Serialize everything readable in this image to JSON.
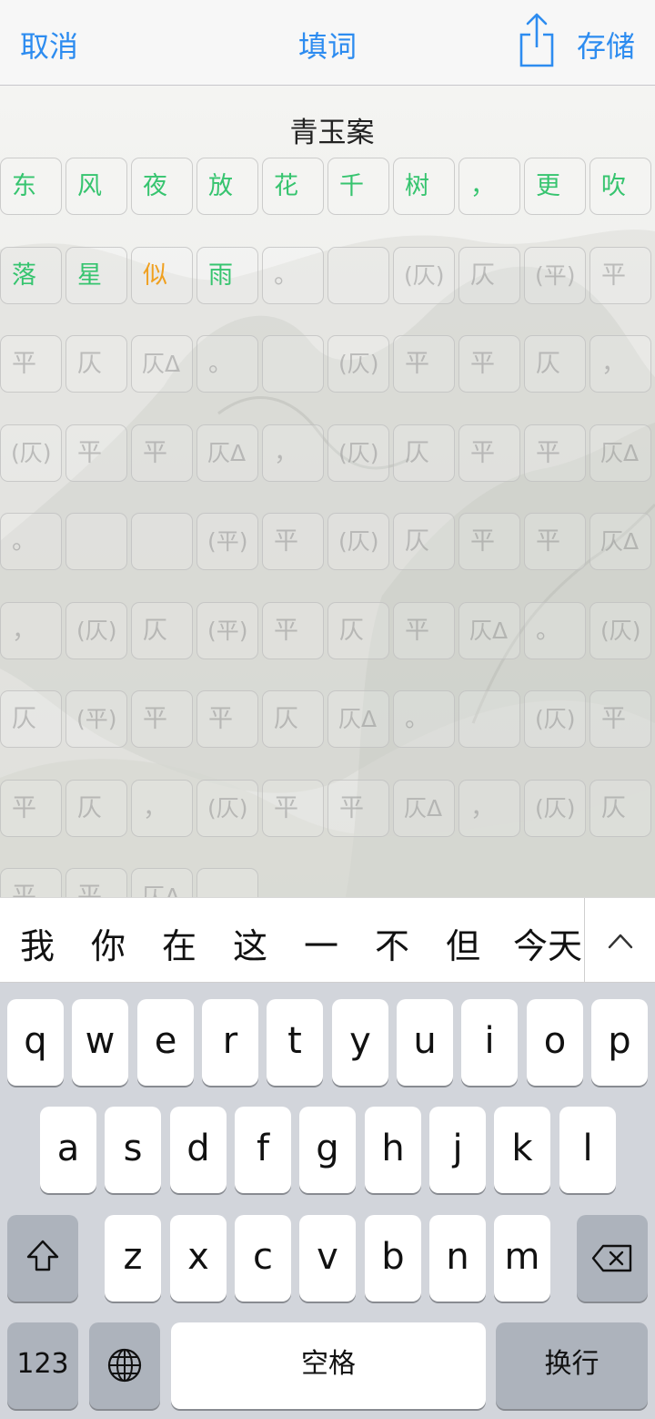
{
  "nav": {
    "cancel": "取消",
    "title": "填词",
    "save": "存储",
    "share_icon": "share-icon"
  },
  "poem": {
    "title": "青玉案",
    "rows": [
      [
        "东",
        "风",
        "夜",
        "放",
        "花",
        "千",
        "树",
        "，",
        "更",
        "吹"
      ],
      [
        "落",
        "星",
        "似",
        "雨",
        "。",
        "",
        "(仄)",
        "仄",
        "(平)",
        "平"
      ],
      [
        "平",
        "仄",
        "仄Δ",
        "。",
        "",
        "(仄)",
        "平",
        "平",
        "仄",
        "，"
      ],
      [
        "(仄)",
        "平",
        "平",
        "仄Δ",
        "，",
        "(仄)",
        "仄",
        "平",
        "平",
        "仄Δ"
      ],
      [
        "。",
        "",
        "",
        "(平)",
        "平",
        "(仄)",
        "仄",
        "平",
        "平",
        "仄Δ"
      ],
      [
        "，",
        "(仄)",
        "仄",
        "(平)",
        "平",
        "仄",
        "平",
        "仄Δ",
        "。",
        "(仄)"
      ],
      [
        "仄",
        "(平)",
        "平",
        "平",
        "仄",
        "仄Δ",
        "。",
        "",
        "(仄)",
        "平"
      ],
      [
        "平",
        "仄",
        "，",
        "(仄)",
        "平",
        "平",
        "仄Δ",
        "，",
        "(仄)",
        "仄"
      ],
      [
        "平",
        "平",
        "仄Δ",
        ""
      ]
    ],
    "filled_count": 14,
    "warn_cells": [
      "1-2"
    ]
  },
  "candidates": [
    "我",
    "你",
    "在",
    "这",
    "一",
    "不",
    "但",
    "今天"
  ],
  "candidates_expand_icon": "chevron-up-icon",
  "keyboard": {
    "row1": [
      "q",
      "w",
      "e",
      "r",
      "t",
      "y",
      "u",
      "i",
      "o",
      "p"
    ],
    "row2": [
      "a",
      "s",
      "d",
      "f",
      "g",
      "h",
      "j",
      "k",
      "l"
    ],
    "row3": [
      "z",
      "x",
      "c",
      "v",
      "b",
      "n",
      "m"
    ],
    "shift_icon": "shift-icon",
    "delete_icon": "delete-icon",
    "numbers_label": "123",
    "globe_icon": "globe-icon",
    "space_label": "空格",
    "return_label": "换行"
  },
  "colors": {
    "accent": "#2d8cf0",
    "filled_text": "#36c46f",
    "warning_text": "#f0a020"
  }
}
